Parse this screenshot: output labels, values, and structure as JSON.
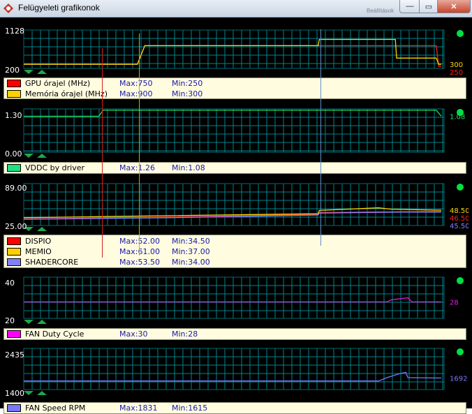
{
  "window": {
    "title": "Felügyeleti grafikonok",
    "icon": "app-gpu-icon",
    "ghost_label": "Beállítások",
    "min_glyph": "—",
    "max_glyph": "▭",
    "close_glyph": "✕"
  },
  "colors": {
    "grid": "#00868b",
    "frame": "#006b6e",
    "status": "#00e040",
    "cursor_red": "#d02020",
    "cursor_yellow": "#b8b800",
    "cursor_blue": "#5f8fc8"
  },
  "panels": [
    {
      "id": "clock",
      "y_max_label": "1128",
      "y_min_label": "200",
      "ylim": [
        200,
        1128
      ],
      "series": [
        {
          "name": "GPU órajel (MHz)",
          "color": "#ff2020",
          "swatch": "#ff0000",
          "max": "Max:750",
          "min": "Min:250",
          "current": "250",
          "points": [
            [
              0,
              300
            ],
            [
              0.272,
              300
            ],
            [
              0.29,
              750
            ],
            [
              0.988,
              750
            ],
            [
              0.994,
              250
            ],
            [
              1,
              250
            ]
          ]
        },
        {
          "name": "Memória órajel (MHz)",
          "color": "#ffd700",
          "swatch": "#ffd000",
          "max": "Max:900",
          "min": "Min:300",
          "current": "300",
          "points": [
            [
              0,
              300
            ],
            [
              0.272,
              300
            ],
            [
              0.29,
              750
            ],
            [
              0.705,
              750
            ],
            [
              0.708,
              900
            ],
            [
              0.89,
              900
            ],
            [
              0.893,
              450
            ],
            [
              0.988,
              450
            ],
            [
              0.994,
              300
            ],
            [
              1,
              300
            ]
          ]
        }
      ]
    },
    {
      "id": "vddc",
      "y_max_label": "1.30",
      "y_min_label": "0.00",
      "ylim": [
        0,
        1.3
      ],
      "series": [
        {
          "name": "VDDC by driver",
          "color": "#20e060",
          "swatch": "#20e080",
          "max": "Max:1.26",
          "min": "Min:1.08",
          "current": "1.08",
          "points": [
            [
              0,
              1.08
            ],
            [
              0.18,
              1.08
            ],
            [
              0.19,
              1.26
            ],
            [
              0.988,
              1.26
            ],
            [
              1,
              1.08
            ]
          ]
        }
      ]
    },
    {
      "id": "temp",
      "y_max_label": "89.00",
      "y_min_label": "25.00",
      "ylim": [
        25,
        89
      ],
      "series": [
        {
          "name": "DISPIO",
          "color": "#ff2020",
          "swatch": "#ff0000",
          "max": "Max:52.00",
          "min": "Min:34.50",
          "current": "46.50",
          "points": [
            [
              0,
              35
            ],
            [
              0.35,
              38
            ],
            [
              0.705,
              42
            ],
            [
              0.708,
              45
            ],
            [
              0.9,
              46
            ],
            [
              0.99,
              46.5
            ],
            [
              1,
              46.5
            ]
          ]
        },
        {
          "name": "MEMIO",
          "color": "#ffd700",
          "swatch": "#ffd000",
          "max": "Max:61.00",
          "min": "Min:37.00",
          "current": "48.50",
          "points": [
            [
              0,
              37
            ],
            [
              0.35,
              40
            ],
            [
              0.705,
              43
            ],
            [
              0.708,
              48
            ],
            [
              0.85,
              52
            ],
            [
              0.88,
              50
            ],
            [
              0.99,
              48.5
            ],
            [
              1,
              48.5
            ]
          ]
        },
        {
          "name": "SHADERCORE",
          "color": "#8080ff",
          "swatch": "#8080ff",
          "max": "Max:53.50",
          "min": "Min:34.00",
          "current": "45.50",
          "points": [
            [
              0,
              34.5
            ],
            [
              0.35,
              37
            ],
            [
              0.705,
              41
            ],
            [
              0.708,
              44
            ],
            [
              0.9,
              45.5
            ],
            [
              0.99,
              45.5
            ],
            [
              1,
              45.5
            ]
          ]
        }
      ]
    },
    {
      "id": "fan",
      "y_max_label": "40",
      "y_min_label": "20",
      "ylim": [
        20,
        40
      ],
      "series": [
        {
          "name": "FAN Duty Cycle",
          "color": "#e020e0",
          "swatch": "#ff00ff",
          "max": "Max:30",
          "min": "Min:28",
          "current": "28",
          "points": [
            [
              0,
              28
            ],
            [
              0.87,
              28
            ],
            [
              0.88,
              29
            ],
            [
              0.92,
              30
            ],
            [
              0.93,
              28
            ],
            [
              1,
              28
            ]
          ]
        }
      ]
    },
    {
      "id": "fanrpm",
      "y_max_label": "2435",
      "y_min_label": "1400",
      "ylim": [
        1400,
        2435
      ],
      "series": [
        {
          "name": "FAN Speed RPM",
          "color": "#7878ff",
          "swatch": "#7878ff",
          "max": "Max:1831",
          "min": "Min:1615",
          "current": "1692",
          "points": [
            [
              0,
              1615
            ],
            [
              0.85,
              1615
            ],
            [
              0.87,
              1700
            ],
            [
              0.9,
              1800
            ],
            [
              0.915,
              1831
            ],
            [
              0.92,
              1700
            ],
            [
              0.99,
              1692
            ],
            [
              1,
              1692
            ]
          ]
        }
      ]
    }
  ]
}
